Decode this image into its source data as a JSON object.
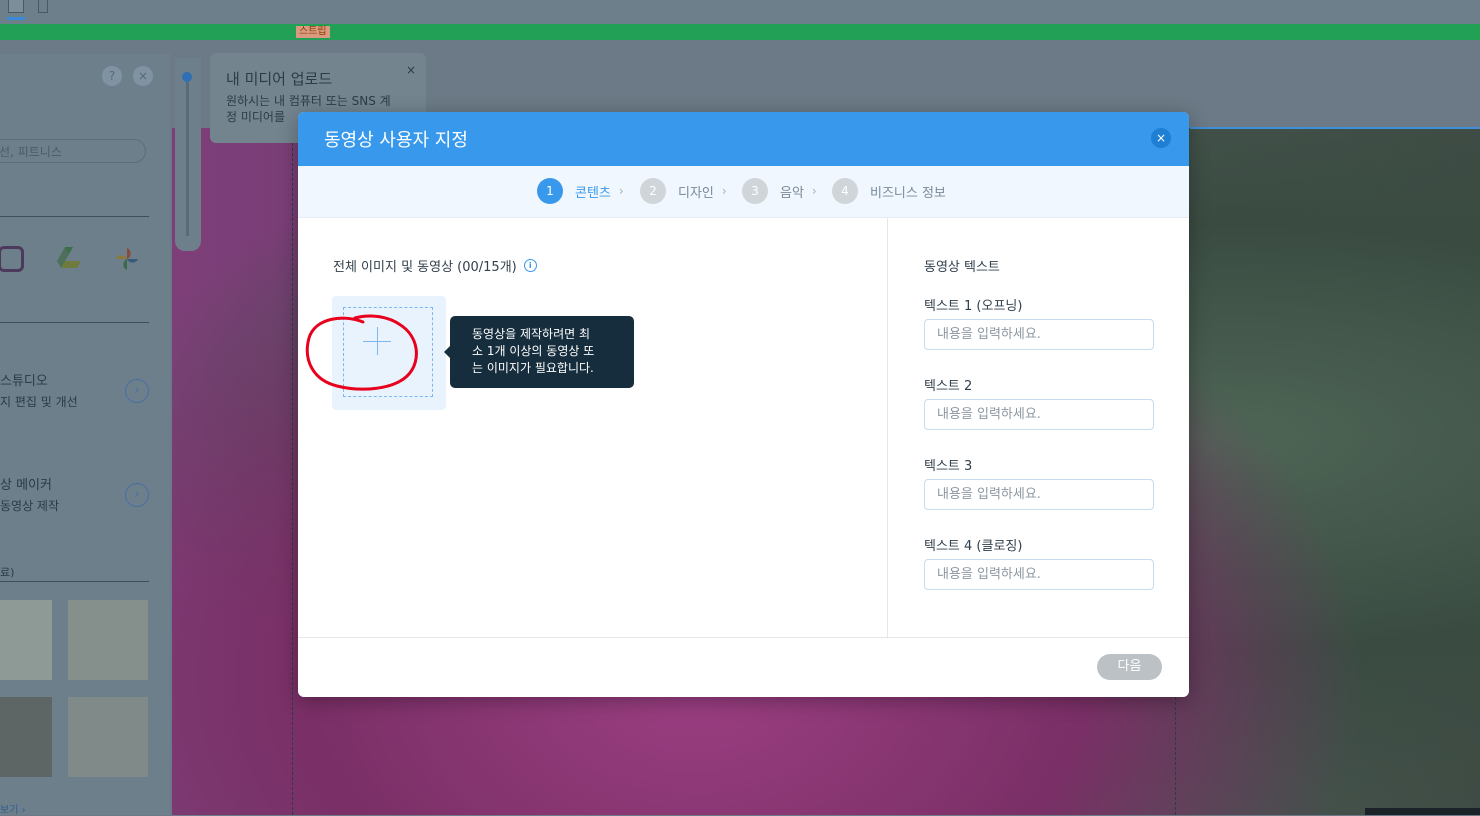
{
  "editor": {
    "strip_tag": "스트립"
  },
  "left_panel": {
    "help_label": "?",
    "close_label": "×",
    "search_placeholder": "선, 피트니스",
    "studio": {
      "title": "스튜디오",
      "subtitle": "지 편집 및 개선"
    },
    "video_maker": {
      "title": "상 메이커",
      "subtitle": "동영상 제작"
    },
    "free_label": "료)",
    "more_label": "보기 ›"
  },
  "upload_tip": {
    "title": "내 미디어 업로드",
    "desc_line1": "원하시는 내 컴퓨터 또는 SNS 계",
    "desc_line2": "정 미디어를",
    "close_label": "×"
  },
  "modal": {
    "title": "동영상 사용자 지정",
    "close_label": "×",
    "steps": [
      {
        "num": "1",
        "label": "콘텐츠",
        "active": true
      },
      {
        "num": "2",
        "label": "디자인",
        "active": false
      },
      {
        "num": "3",
        "label": "음악",
        "active": false
      },
      {
        "num": "4",
        "label": "비즈니스 정보",
        "active": false
      }
    ],
    "media_title": "전체 이미지 및 동영상 (00/15개)",
    "tooltip_line1": "동영상을 제작하려면 최",
    "tooltip_line2": "소 1개 이상의 동영상 또",
    "tooltip_line3": "는 이미지가 필요합니다.",
    "text_section_title": "동영상 텍스트",
    "fields": [
      {
        "label": "텍스트 1 (오프닝)",
        "placeholder": "내용을 입력하세요.",
        "value": ""
      },
      {
        "label": "텍스트 2",
        "placeholder": "내용을 입력하세요.",
        "value": ""
      },
      {
        "label": "텍스트 3",
        "placeholder": "내용을 입력하세요.",
        "value": ""
      },
      {
        "label": "텍스트 4 (클로징)",
        "placeholder": "내용을 입력하세요.",
        "value": ""
      }
    ],
    "next_label": "다음"
  },
  "colors": {
    "accent": "#3899ec",
    "tooltip_bg": "#162d3d",
    "annotation": "#e8001c",
    "disabled_button": "#bcc1c5"
  },
  "icons": {
    "upload_plus": "plus-icon",
    "info": "info-icon",
    "close": "close-icon",
    "step_separator": "chevron-right-icon"
  }
}
